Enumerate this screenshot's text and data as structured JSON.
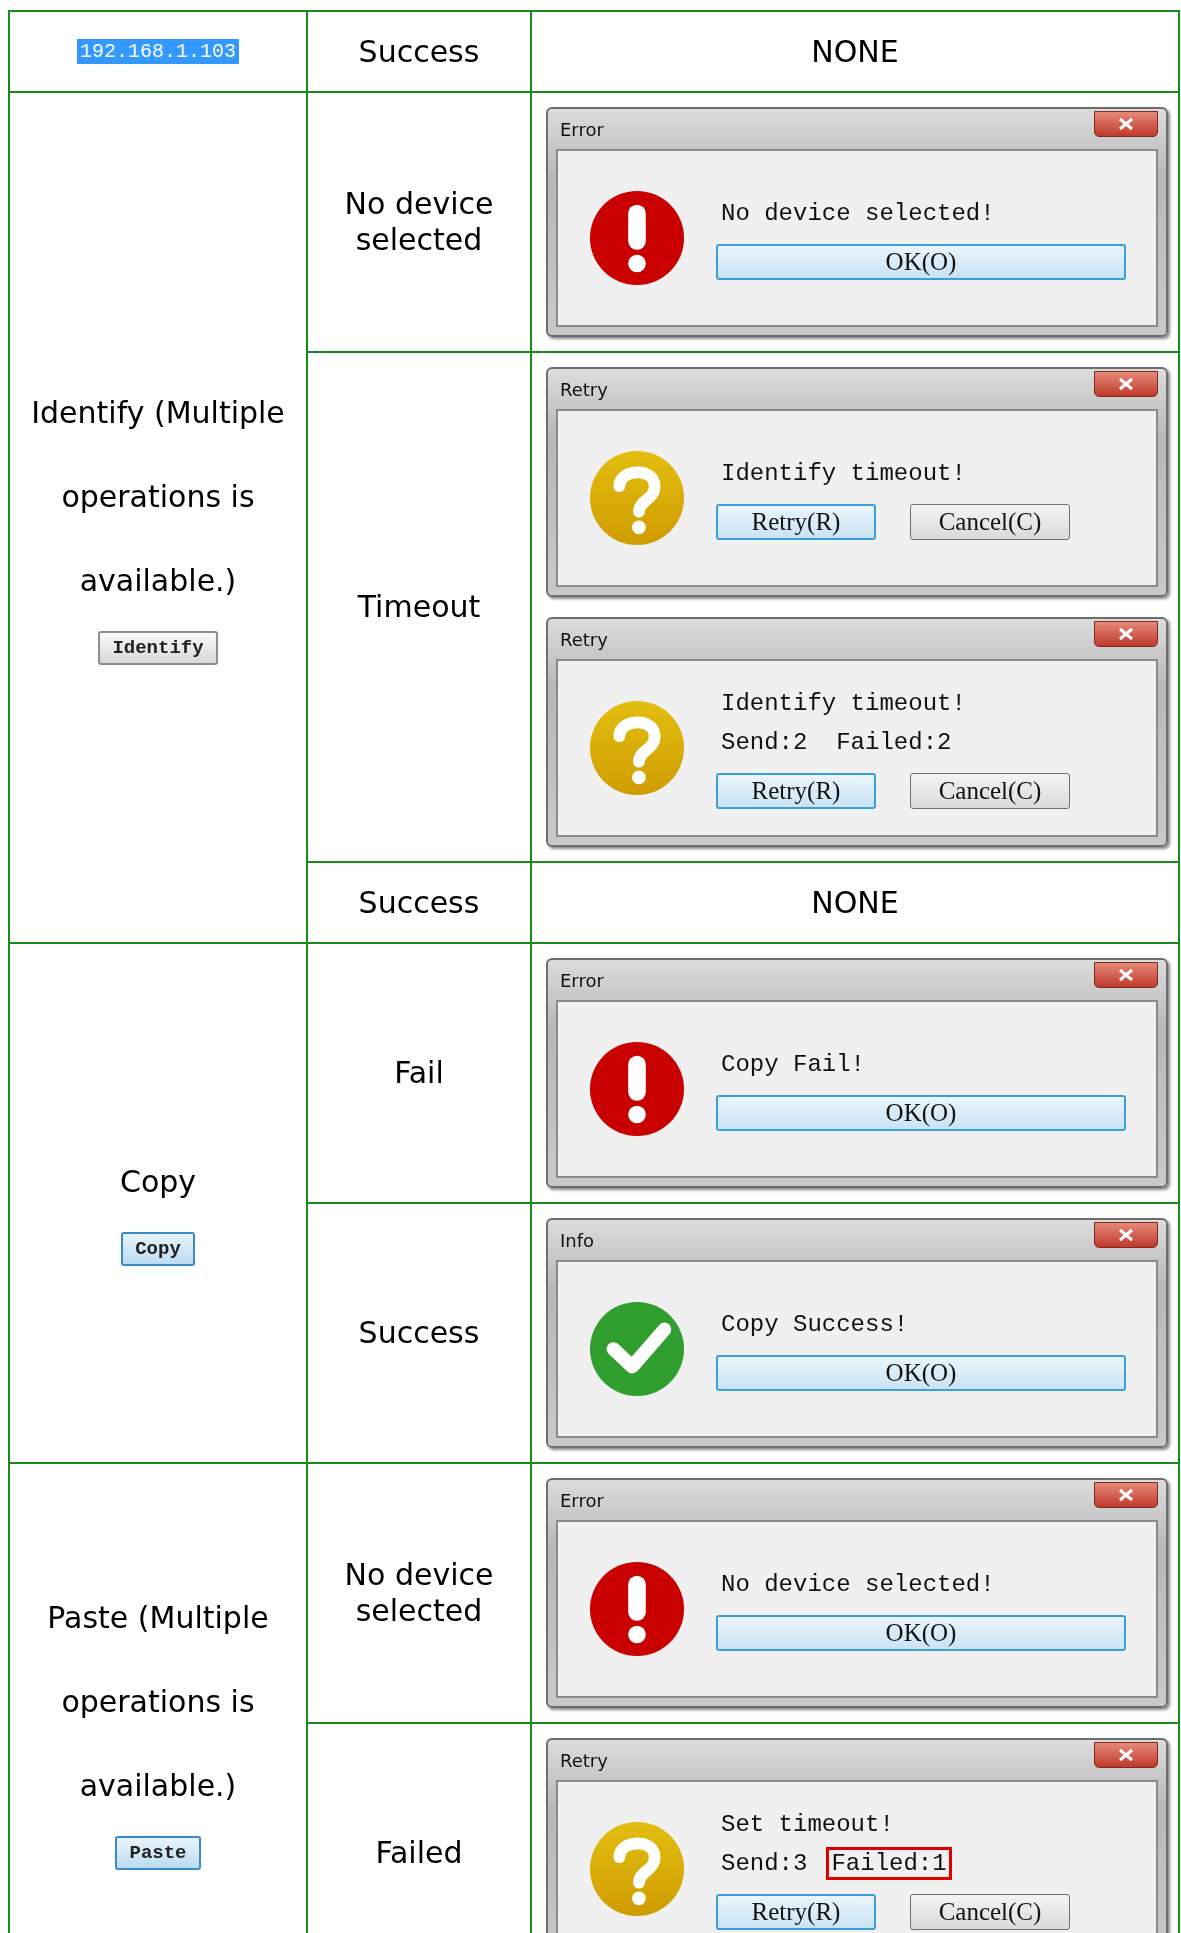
{
  "table": {
    "groups": [
      {
        "operation": {
          "kind": "address",
          "text": "192.168.1.103"
        },
        "results": [
          {
            "result": "Success",
            "response": "NONE"
          }
        ]
      },
      {
        "operation": {
          "kind": "command",
          "text": "Identify (Multiple operations is available.)",
          "button": {
            "label": "Identify",
            "focused": false
          }
        },
        "results": [
          {
            "result": "No device selected",
            "dialogs": [
              {
                "kind": "error",
                "title": "Error",
                "lines": [
                  [
                    {
                      "text": "No device selected!",
                      "highlighted": false
                    }
                  ]
                ],
                "buttons": [
                  {
                    "label": "OK(O)",
                    "default": true
                  }
                ]
              }
            ]
          },
          {
            "result": "Timeout",
            "dialogs": [
              {
                "kind": "question",
                "title": "Retry",
                "lines": [
                  [
                    {
                      "text": "Identify timeout!",
                      "highlighted": false
                    }
                  ]
                ],
                "buttons": [
                  {
                    "label": "Retry(R)",
                    "default": true
                  },
                  {
                    "label": "Cancel(C)",
                    "default": false
                  }
                ]
              },
              {
                "kind": "question",
                "title": "Retry",
                "lines": [
                  [
                    {
                      "text": "Identify timeout!",
                      "highlighted": false
                    }
                  ],
                  [
                    {
                      "text": "Send:2  Failed:2",
                      "highlighted": false
                    }
                  ]
                ],
                "buttons": [
                  {
                    "label": "Retry(R)",
                    "default": true
                  },
                  {
                    "label": "Cancel(C)",
                    "default": false
                  }
                ]
              }
            ]
          },
          {
            "result": "Success",
            "response": "NONE"
          }
        ]
      },
      {
        "operation": {
          "kind": "command",
          "text": "Copy",
          "button": {
            "label": "Copy",
            "focused": true
          }
        },
        "results": [
          {
            "result": "Fail",
            "dialogs": [
              {
                "kind": "error",
                "title": "Error",
                "lines": [
                  [
                    {
                      "text": "Copy Fail!",
                      "highlighted": false
                    }
                  ]
                ],
                "buttons": [
                  {
                    "label": "OK(O)",
                    "default": true
                  }
                ]
              }
            ]
          },
          {
            "result": "Success",
            "dialogs": [
              {
                "kind": "success",
                "title": "Info",
                "lines": [
                  [
                    {
                      "text": "Copy Success!",
                      "highlighted": false
                    }
                  ]
                ],
                "buttons": [
                  {
                    "label": "OK(O)",
                    "default": true
                  }
                ]
              }
            ]
          }
        ]
      },
      {
        "operation": {
          "kind": "command",
          "text": "Paste (Multiple operations is available.)",
          "button": {
            "label": "Paste",
            "focused": true
          }
        },
        "results": [
          {
            "result": "No device selected",
            "dialogs": [
              {
                "kind": "error",
                "title": "Error",
                "lines": [
                  [
                    {
                      "text": "No device selected!",
                      "highlighted": false
                    }
                  ]
                ],
                "buttons": [
                  {
                    "label": "OK(O)",
                    "default": true
                  }
                ]
              }
            ]
          },
          {
            "result": "Failed",
            "dialogs": [
              {
                "kind": "question",
                "title": "Retry",
                "lines": [
                  [
                    {
                      "text": "Set timeout!",
                      "highlighted": false
                    }
                  ],
                  [
                    {
                      "text": "Send:3",
                      "highlighted": false
                    },
                    {
                      "text": "Failed:1",
                      "highlighted": true
                    }
                  ]
                ],
                "buttons": [
                  {
                    "label": "Retry(R)",
                    "default": true
                  },
                  {
                    "label": "Cancel(C)",
                    "default": false
                  }
                ]
              }
            ]
          }
        ]
      }
    ]
  }
}
